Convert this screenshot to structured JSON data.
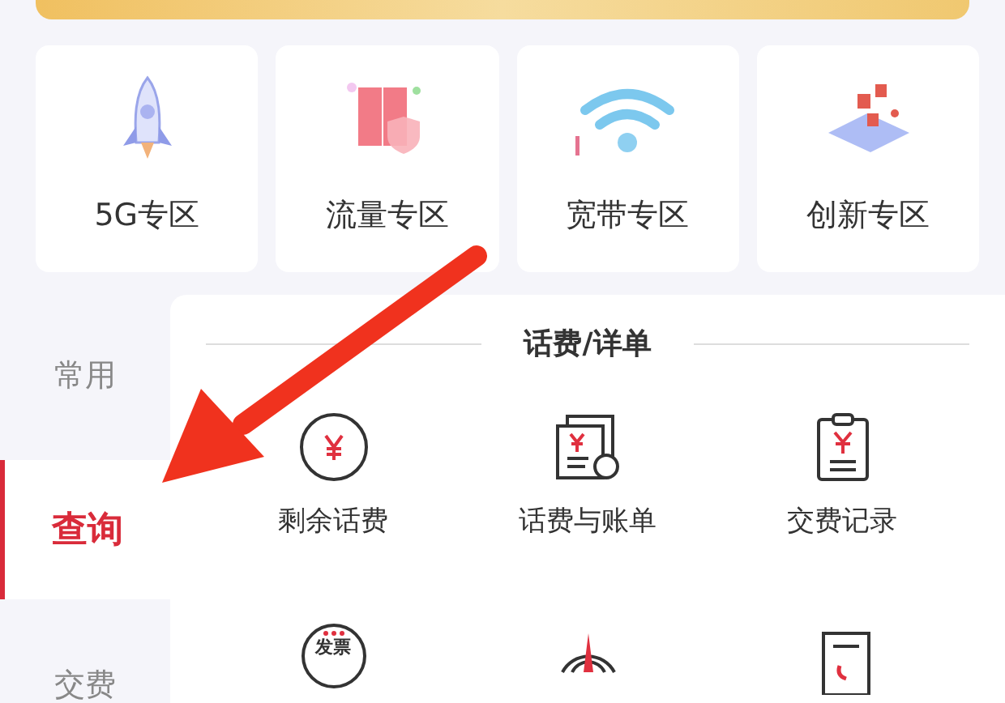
{
  "zones": [
    {
      "label": "5G专区",
      "kind": "rocket"
    },
    {
      "label": "流量专区",
      "kind": "cabinet"
    },
    {
      "label": "宽带专区",
      "kind": "wifi"
    },
    {
      "label": "创新专区",
      "kind": "laptop"
    }
  ],
  "sidebar": {
    "items": [
      {
        "label": "常用",
        "selected": false
      },
      {
        "label": "查询",
        "selected": true
      },
      {
        "label": "交费",
        "selected": false
      }
    ]
  },
  "section": {
    "title": "话费/详单",
    "items": [
      {
        "label": "剩余话费",
        "kind": "coin"
      },
      {
        "label": "话费与账单",
        "kind": "bill"
      },
      {
        "label": "交费记录",
        "kind": "clipboard"
      }
    ],
    "next_row": [
      {
        "kind": "invoice",
        "icon_text": "发票"
      },
      {
        "kind": "compass"
      },
      {
        "kind": "phone-doc"
      }
    ]
  },
  "annotations": [
    {
      "kind": "arrow"
    }
  ]
}
